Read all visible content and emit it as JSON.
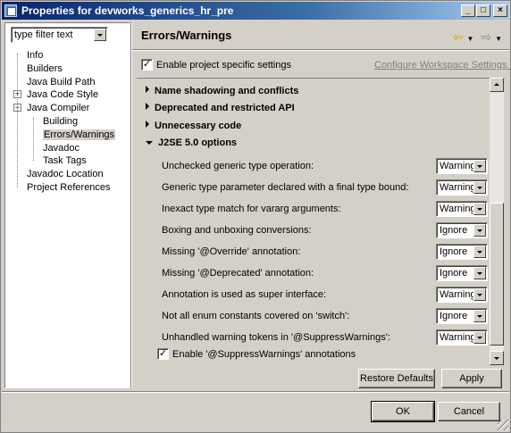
{
  "window": {
    "title": "Properties for devworks_generics_hr_pre"
  },
  "filter": {
    "value": "type filter text"
  },
  "tree": {
    "items": [
      {
        "label": "Info",
        "level": 0,
        "expander": ""
      },
      {
        "label": "Builders",
        "level": 0,
        "expander": ""
      },
      {
        "label": "Java Build Path",
        "level": 0,
        "expander": ""
      },
      {
        "label": "Java Code Style",
        "level": 0,
        "expander": "+"
      },
      {
        "label": "Java Compiler",
        "level": 0,
        "expander": "-"
      },
      {
        "label": "Building",
        "level": 1,
        "expander": ""
      },
      {
        "label": "Errors/Warnings",
        "level": 1,
        "expander": "",
        "selected": true
      },
      {
        "label": "Javadoc",
        "level": 1,
        "expander": ""
      },
      {
        "label": "Task Tags",
        "level": 1,
        "expander": ""
      },
      {
        "label": "Javadoc Location",
        "level": 0,
        "expander": ""
      },
      {
        "label": "Project References",
        "level": 0,
        "expander": ""
      }
    ]
  },
  "page": {
    "title": "Errors/Warnings",
    "enable_project_settings": {
      "label": "Enable project specific settings",
      "checked": true
    },
    "configure_link": "Configure Workspace Settings...",
    "sections": [
      {
        "label": "Name shadowing and conflicts",
        "expanded": false
      },
      {
        "label": "Deprecated and restricted API",
        "expanded": false
      },
      {
        "label": "Unnecessary code",
        "expanded": false
      },
      {
        "label": "J2SE 5.0 options",
        "expanded": true
      }
    ],
    "options": [
      {
        "label": "Unchecked generic type operation:",
        "value": "Warning"
      },
      {
        "label": "Generic type parameter declared with a final type bound:",
        "value": "Warning"
      },
      {
        "label": "Inexact type match for vararg arguments:",
        "value": "Warning"
      },
      {
        "label": "Boxing and unboxing conversions:",
        "value": "Ignore"
      },
      {
        "label": "Missing '@Override' annotation:",
        "value": "Ignore"
      },
      {
        "label": "Missing '@Deprecated' annotation:",
        "value": "Ignore"
      },
      {
        "label": "Annotation is used as super interface:",
        "value": "Warning"
      },
      {
        "label": "Not all enum constants covered on 'switch':",
        "value": "Ignore"
      },
      {
        "label": "Unhandled warning tokens in '@SuppressWarnings':",
        "value": "Warning"
      }
    ],
    "suppress_warnings": {
      "label": "Enable '@SuppressWarnings' annotations",
      "checked": true
    },
    "restore_defaults": "Restore Defaults",
    "apply": "Apply"
  },
  "footer": {
    "ok": "OK",
    "cancel": "Cancel"
  }
}
